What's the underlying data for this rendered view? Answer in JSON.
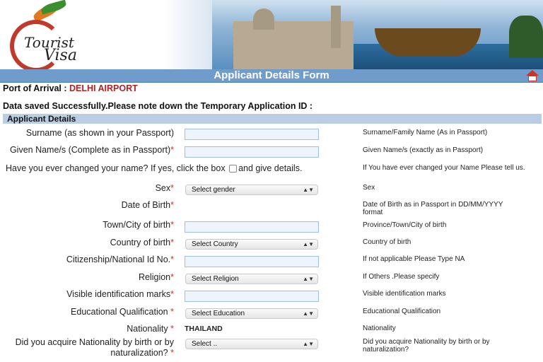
{
  "banner": {
    "logo_word1": "Tourist",
    "logo_word2": "Visa"
  },
  "header": {
    "title": "Applicant Details Form",
    "home_icon": "home-icon"
  },
  "port": {
    "label": "Port of Arrival :",
    "value": "DELHI AIRPORT"
  },
  "saved_message": "Data saved Successfully.Please note down the Temporary Application ID :",
  "section_title": "Applicant Details",
  "rows": {
    "surname": {
      "label": "Surname (as shown in your Passport)",
      "hint": "Surname/Family Name (As in Passport)",
      "value": ""
    },
    "given": {
      "label": "Given Name/s (Complete as in Passport)",
      "req": "*",
      "hint": "Given Name/s (exactly as in Passport)",
      "value": ""
    },
    "changed": {
      "label_a": "Have you ever changed your name? If yes, click the box",
      "label_b": "and give details.",
      "hint": "If You have ever changed your Name Please tell us."
    },
    "sex": {
      "label": "Sex",
      "req": "*",
      "select": "Select gender",
      "hint": "Sex"
    },
    "dob": {
      "label": "Date of Birth",
      "req": "*",
      "hint": "Date of Birth as in Passport in DD/MM/YYYY format"
    },
    "town": {
      "label": "Town/City of birth",
      "req": "*",
      "hint": "Province/Town/City of birth",
      "value": ""
    },
    "country": {
      "label": "Country of birth",
      "req": "*",
      "select": "Select Country",
      "hint": "Country of birth"
    },
    "natid": {
      "label": "Citizenship/National Id No.",
      "req": "*",
      "hint": "If not applicable Please Type NA",
      "value": ""
    },
    "religion": {
      "label": "Religion",
      "req": "*",
      "select": "Select Religion",
      "hint": "If Others .Please specify"
    },
    "marks": {
      "label": "Visible identification marks",
      "req": "*",
      "hint": "Visible identification marks",
      "value": ""
    },
    "edu": {
      "label": "Educational Qualification",
      "req": "*",
      "select": "Select Education",
      "hint": "Educational Qualification"
    },
    "nationality": {
      "label": "Nationality",
      "req": "*",
      "value": "THAILAND",
      "hint": "Nationality"
    },
    "acquire": {
      "label_a": "Did you acquire Nationality by birth or by",
      "label_b": "naturalization?",
      "req": "*",
      "select": "Select ..",
      "hint": "Did you acquire Nationality by birth or by naturalization?"
    }
  },
  "colors": {
    "title_bar": "#6f9ccb",
    "section_bar": "#b9cde3",
    "required": "#d0302a",
    "port_value": "#b22222"
  }
}
